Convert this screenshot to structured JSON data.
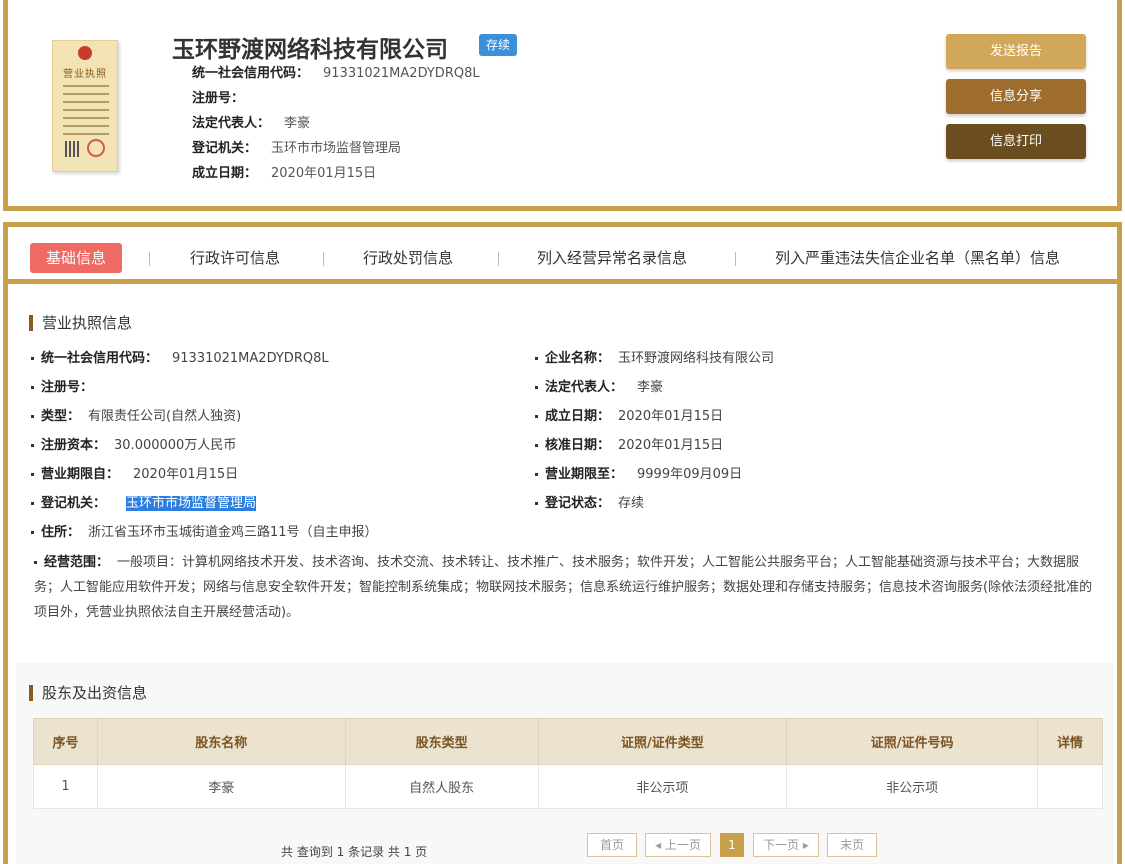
{
  "header": {
    "company_name": "玉环野渡网络科技有限公司",
    "status_badge": "存续",
    "license_title": "营业执照",
    "fields": [
      {
        "label": "统一社会信用代码：",
        "value": "91331021MA2DYDRQ8L"
      },
      {
        "label": "注册号：",
        "value": ""
      },
      {
        "label": "法定代表人：",
        "value": "李豪"
      },
      {
        "label": "登记机关：",
        "value": "玉环市市场监督管理局"
      },
      {
        "label": "成立日期：",
        "value": "2020年01月15日"
      }
    ],
    "buttons": {
      "send": "发送报告",
      "share": "信息分享",
      "print": "信息打印"
    }
  },
  "tabs": [
    "基础信息",
    "行政许可信息",
    "行政处罚信息",
    "列入经营异常名录信息",
    "列入严重违法失信企业名单（黑名单）信息"
  ],
  "license_section": {
    "title": "营业执照信息",
    "left": [
      {
        "label": "统一社会信用代码：",
        "value": "91331021MA2DYDRQ8L"
      },
      {
        "label": "注册号：",
        "value": ""
      },
      {
        "label": "类型：",
        "value": "有限责任公司(自然人独资)"
      },
      {
        "label": "注册资本：",
        "value": "30.000000万人民币"
      },
      {
        "label": "营业期限自：",
        "value": "2020年01月15日"
      },
      {
        "label": "登记机关：",
        "value": "玉环市市场监督管理局"
      },
      {
        "label": "住所：",
        "value": "浙江省玉环市玉城街道金鸡三路11号（自主申报）"
      }
    ],
    "right": [
      {
        "label": "企业名称：",
        "value": "玉环野渡网络科技有限公司"
      },
      {
        "label": "法定代表人：",
        "value": "李豪"
      },
      {
        "label": "成立日期：",
        "value": "2020年01月15日"
      },
      {
        "label": "核准日期：",
        "value": "2020年01月15日"
      },
      {
        "label": "营业期限至：",
        "value": "9999年09月09日"
      },
      {
        "label": "登记状态：",
        "value": "存续"
      }
    ],
    "scope_label": "经营范围：",
    "scope_value": "一般项目：计算机网络技术开发、技术咨询、技术交流、技术转让、技术推广、技术服务；软件开发；人工智能公共服务平台；人工智能基础资源与技术平台；大数据服务；人工智能应用软件开发；网络与信息安全软件开发；智能控制系统集成；物联网技术服务；信息系统运行维护服务；数据处理和存储支持服务；信息技术咨询服务(除依法须经批准的项目外，凭营业执照依法自主开展经营活动)。"
  },
  "shareholders": {
    "title": "股东及出资信息",
    "columns": [
      "序号",
      "股东名称",
      "股东类型",
      "证照/证件类型",
      "证照/证件号码",
      "详情"
    ],
    "rows": [
      [
        "1",
        "李豪",
        "自然人股东",
        "非公示项",
        "非公示项",
        ""
      ]
    ],
    "pager_text": "共 查询到 1 条记录 共 1 页",
    "pager": {
      "first": "首页",
      "prev": "◂ 上一页",
      "current": "1",
      "next": "下一页 ▸",
      "last": "末页"
    }
  }
}
